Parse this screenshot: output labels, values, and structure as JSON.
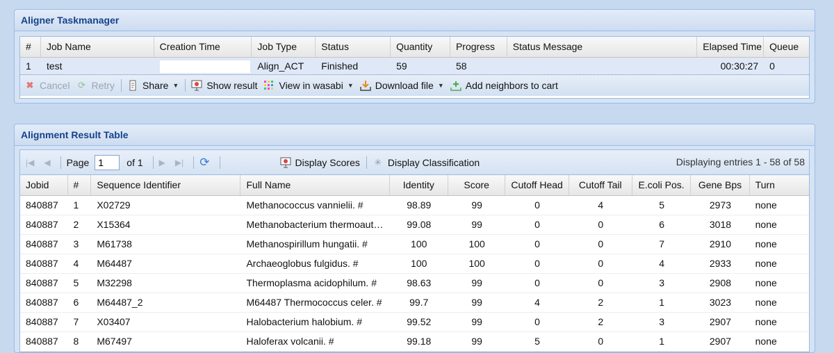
{
  "taskmanager": {
    "title": "Aligner Taskmanager",
    "columns": [
      "#",
      "Job Name",
      "Creation Time",
      "Job Type",
      "Status",
      "Quantity",
      "Progress",
      "Status Message",
      "Elapsed Time",
      "Queue"
    ],
    "row": {
      "num": "1",
      "job_name": "test",
      "creation_time": "",
      "job_type": "Align_ACT",
      "status": "Finished",
      "quantity": "59",
      "progress": "58",
      "status_message": "",
      "elapsed": "00:30:27",
      "queue": "0"
    },
    "toolbar": {
      "cancel": "Cancel",
      "retry": "Retry",
      "share": "Share",
      "show_result": "Show result",
      "view_wasabi": "View in wasabi",
      "download": "Download file",
      "add_neighbors": "Add neighbors to cart"
    }
  },
  "results": {
    "title": "Alignment Result Table",
    "paging": {
      "page_label": "Page",
      "page_value": "1",
      "of_label": "of 1",
      "display_scores": "Display Scores",
      "display_classification": "Display Classification",
      "info": "Displaying entries 1 - 58 of 58"
    },
    "columns": [
      "Jobid",
      "#",
      "Sequence Identifier",
      "Full Name",
      "Identity",
      "Score",
      "Cutoff Head",
      "Cutoff Tail",
      "E.coli Pos.",
      "Gene Bps",
      "Turn"
    ],
    "rows": [
      [
        "840887",
        "1",
        "X02729",
        "Methanococcus vannielii. #",
        "98.89",
        "99",
        "0",
        "4",
        "5",
        "2973",
        "none"
      ],
      [
        "840887",
        "2",
        "X15364",
        "Methanobacterium thermoautotrophicum. #",
        "99.08",
        "99",
        "0",
        "0",
        "6",
        "3018",
        "none"
      ],
      [
        "840887",
        "3",
        "M61738",
        "Methanospirillum hungatii. #",
        "100",
        "100",
        "0",
        "0",
        "7",
        "2910",
        "none"
      ],
      [
        "840887",
        "4",
        "M64487",
        "Archaeoglobus fulgidus. #",
        "100",
        "100",
        "0",
        "0",
        "4",
        "2933",
        "none"
      ],
      [
        "840887",
        "5",
        "M32298",
        "Thermoplasma acidophilum. #",
        "98.63",
        "99",
        "0",
        "0",
        "3",
        "2908",
        "none"
      ],
      [
        "840887",
        "6",
        "M64487_2",
        "M64487 Thermococcus celer. #",
        "99.7",
        "99",
        "4",
        "2",
        "1",
        "3023",
        "none"
      ],
      [
        "840887",
        "7",
        "X03407",
        "Halobacterium halobium. #",
        "99.52",
        "99",
        "0",
        "2",
        "3",
        "2907",
        "none"
      ],
      [
        "840887",
        "8",
        "M67497",
        "Haloferax volcanii. #",
        "99.18",
        "99",
        "5",
        "0",
        "1",
        "2907",
        "none"
      ]
    ]
  }
}
